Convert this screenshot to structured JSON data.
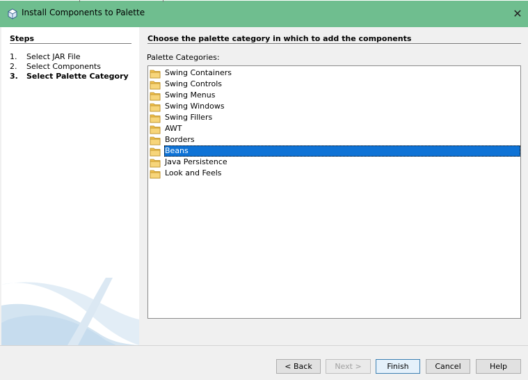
{
  "window": {
    "title": "Install Components to Palette",
    "close_glyph": "✕"
  },
  "steps": {
    "heading": "Steps",
    "items": [
      {
        "num": "1.",
        "label": "Select JAR File"
      },
      {
        "num": "2.",
        "label": "Select Components"
      },
      {
        "num": "3.",
        "label": "Select Palette Category"
      }
    ],
    "current_index": 2
  },
  "main": {
    "heading": "Choose the palette category in which to add the components",
    "list_label": "Palette Categories:",
    "categories": [
      "Swing Containers",
      "Swing Controls",
      "Swing Menus",
      "Swing Windows",
      "Swing Fillers",
      "AWT",
      "Borders",
      "Beans",
      "Java Persistence",
      "Look and Feels"
    ],
    "selected": "Beans"
  },
  "buttons": {
    "back": "< Back",
    "next": "Next >",
    "finish": "Finish",
    "cancel": "Cancel",
    "help": "Help"
  },
  "colors": {
    "titlebar": "#6fbe8f",
    "selection": "#0f73d6",
    "folder": "#f2c14e"
  }
}
